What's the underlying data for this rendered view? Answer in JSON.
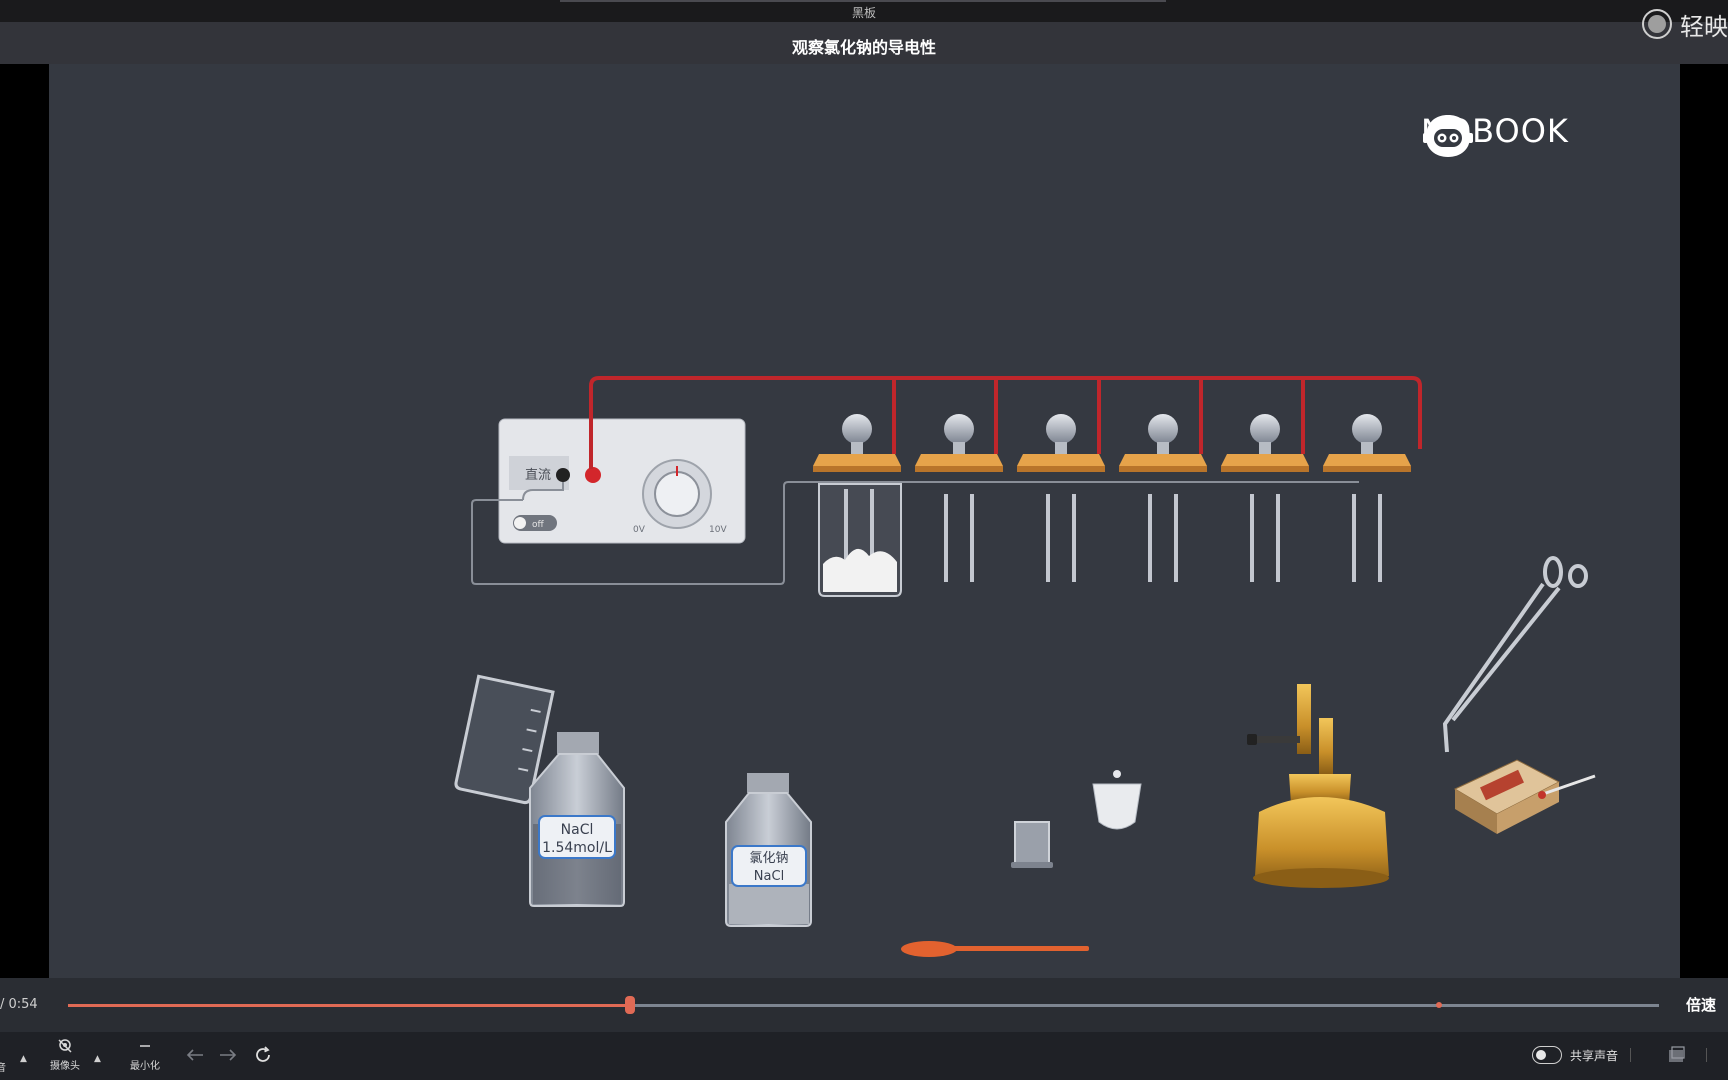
{
  "window": {
    "title": "黑板",
    "brand_text": "轻映"
  },
  "page": {
    "title": "观察氯化钠的导电性"
  },
  "stage": {
    "logo_text": "NOBOOK",
    "power_supply": {
      "mode_label": "直流",
      "switch_label": "off"
    },
    "reagent_bottle_1": {
      "line1": "NaCl",
      "line2": "1.54mol/L"
    },
    "reagent_bottle_2": {
      "line1": "氯化钠",
      "line2": "NaCl"
    }
  },
  "player": {
    "time_text": "/ 0:54",
    "progress": 0.353,
    "marker": 0.862,
    "speed_label": "倍速"
  },
  "toolbar": {
    "camera_label": "摄像头",
    "minimize_label": "最小化",
    "share_audio_label": "共享声音",
    "left_stub_label": "音"
  },
  "colors": {
    "accent": "#e06a55",
    "stage_bg": "#353941",
    "wire_red": "#c0262b"
  }
}
